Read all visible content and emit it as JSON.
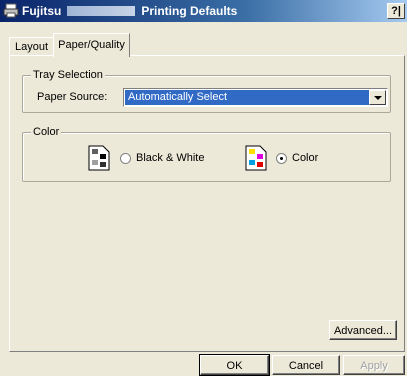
{
  "window": {
    "title_prefix": "Fujitsu",
    "title_suffix": "Printing Defaults",
    "help_label": "?|"
  },
  "tabs": [
    {
      "label": "Layout",
      "active": false
    },
    {
      "label": "Paper/Quality",
      "active": true
    }
  ],
  "tray": {
    "legend": "Tray Selection",
    "source_label": "Paper Source:",
    "source_value": "Automatically Select"
  },
  "color": {
    "legend": "Color",
    "bw_label": "Black & White",
    "color_label": "Color",
    "selected": "Color"
  },
  "buttons": {
    "advanced": "Advanced...",
    "ok": "OK",
    "cancel": "Cancel",
    "apply": "Apply"
  }
}
